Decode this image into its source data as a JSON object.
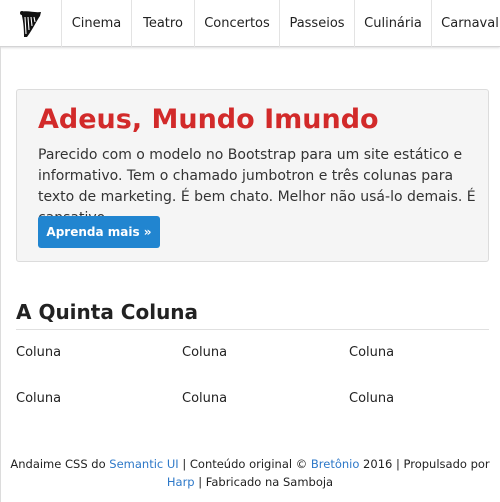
{
  "nav": {
    "items": [
      {
        "label": "Cinema"
      },
      {
        "label": "Teatro"
      },
      {
        "label": "Concertos"
      },
      {
        "label": "Passeios"
      },
      {
        "label": "Culinária"
      },
      {
        "label": "Carnaval"
      }
    ]
  },
  "jumbotron": {
    "title": "Adeus, Mundo Imundo",
    "text": "Parecido com o modelo no Bootstrap para um site estático e informativo. Tem o chamado jumbotron e três colunas para texto de marketing. É bem chato. Melhor não usá-lo demais. É cansativo.",
    "button_label": "Aprenda mais »",
    "title_color": "#d22a2a",
    "button_color": "#2185d0"
  },
  "section": {
    "title": "A Quinta Coluna",
    "columns": [
      "Coluna",
      "Coluna",
      "Coluna",
      "Coluna",
      "Coluna",
      "Coluna"
    ]
  },
  "footer": {
    "t1": "Andaime CSS do ",
    "link_semantic": "Semantic UI",
    "t2": " | Conteúdo original © ",
    "link_bretonio": "Bretônio",
    "t3": " 2016 | Propulsado por ",
    "link_harp": "Harp",
    "t4": " | Fabricado na Samboja",
    "link_color": "#2d78c8"
  },
  "icons": {
    "logo": "harp-icon"
  }
}
